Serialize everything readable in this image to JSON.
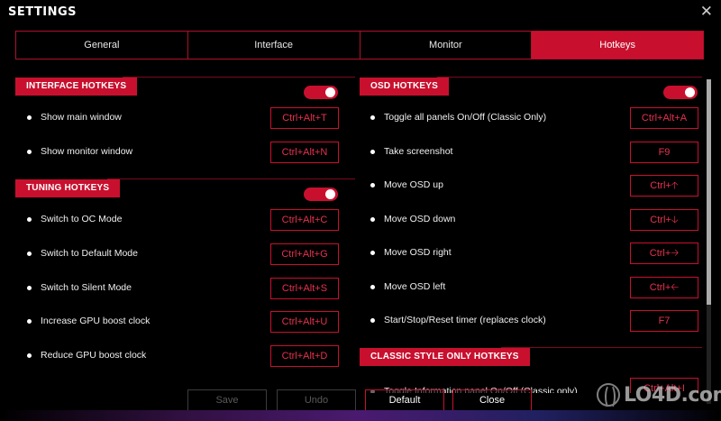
{
  "window": {
    "title": "SETTINGS",
    "close_glyph": "✕"
  },
  "tabs": [
    {
      "label": "General",
      "active": false
    },
    {
      "label": "Interface",
      "active": false
    },
    {
      "label": "Monitor",
      "active": false
    },
    {
      "label": "Hotkeys",
      "active": true
    }
  ],
  "interface_hotkeys": {
    "title": "INTERFACE HOTKEYS",
    "enabled": true,
    "rows": [
      {
        "label": "Show main window",
        "key": "Ctrl+Alt+T"
      },
      {
        "label": "Show monitor window",
        "key": "Ctrl+Alt+N"
      }
    ]
  },
  "tuning_hotkeys": {
    "title": "TUNING HOTKEYS",
    "enabled": true,
    "rows": [
      {
        "label": "Switch to OC Mode",
        "key": "Ctrl+Alt+C"
      },
      {
        "label": "Switch to Default Mode",
        "key": "Ctrl+Alt+G"
      },
      {
        "label": "Switch to Silent Mode",
        "key": "Ctrl+Alt+S"
      },
      {
        "label": "Increase GPU boost clock",
        "key": "Ctrl+Alt+U"
      },
      {
        "label": "Reduce GPU boost clock",
        "key": "Ctrl+Alt+D"
      }
    ]
  },
  "osd_hotkeys": {
    "title": "OSD HOTKEYS",
    "enabled": true,
    "rows": [
      {
        "label": "Toggle all panels On/Off (Classic Only)",
        "key": "Ctrl+Alt+A"
      },
      {
        "label": "Take screenshot",
        "key": "F9"
      },
      {
        "label": "Move OSD up",
        "key": "Ctrl+🡡"
      },
      {
        "label": "Move OSD down",
        "key": "Ctrl+🡣"
      },
      {
        "label": "Move OSD right",
        "key": "Ctrl+🡢"
      },
      {
        "label": "Move OSD left",
        "key": "Ctrl+🡠"
      },
      {
        "label": "Start/Stop/Reset timer (replaces clock)",
        "key": "F7"
      }
    ]
  },
  "classic_hotkeys": {
    "title": "CLASSIC STYLE ONLY HOTKEYS",
    "rows": [
      {
        "label": "Toggle Information panel On/Off (Classic only)",
        "key": "Ctrl+Alt+I"
      }
    ]
  },
  "buttons": {
    "save": "Save",
    "undo": "Undo",
    "default": "Default",
    "close": "Close"
  },
  "watermark": {
    "text": "LO4D.com"
  },
  "colors": {
    "accent": "#c8102e",
    "background": "#000000"
  }
}
